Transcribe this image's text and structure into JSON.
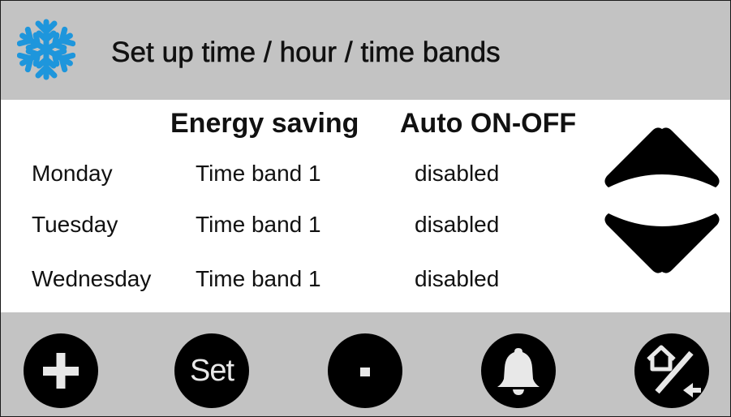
{
  "header": {
    "title": "Set up time / hour / time bands",
    "icon": "snowflake-icon",
    "icon_color": "#1e96dc"
  },
  "table": {
    "columns": [
      "Energy saving",
      "Auto ON-OFF"
    ],
    "rows": [
      {
        "day": "Monday",
        "energy_saving": "Time band 1",
        "auto_on_off": "disabled"
      },
      {
        "day": "Tuesday",
        "energy_saving": "Time band 1",
        "auto_on_off": "disabled"
      },
      {
        "day": "Wednesday",
        "energy_saving": "Time band 1",
        "auto_on_off": "disabled"
      }
    ]
  },
  "navigation": {
    "up_icon": "arrow-up-icon",
    "down_icon": "arrow-down-icon"
  },
  "footer": {
    "buttons": [
      {
        "icon": "plus-icon"
      },
      {
        "label": "Set"
      },
      {
        "icon": "minus-icon"
      },
      {
        "icon": "bell-icon"
      },
      {
        "icon": "home-back-icon"
      }
    ]
  },
  "colors": {
    "bar_background": "#c3c3c3",
    "button_fill": "#000000",
    "button_glyph": "#e8e8e8"
  }
}
